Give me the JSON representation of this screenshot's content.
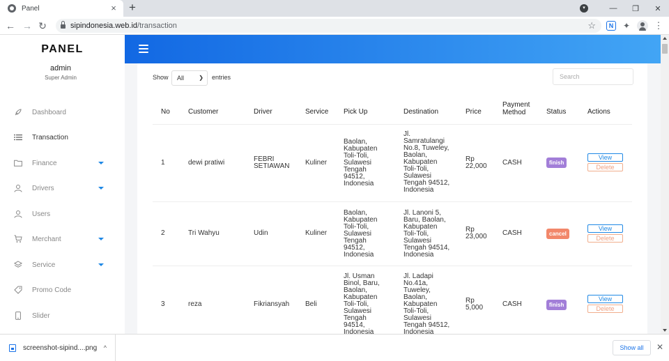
{
  "browser": {
    "tab_title": "Panel",
    "tab_close": "×",
    "new_tab": "+",
    "url_host": "sipindonesia.web.id",
    "url_path": "/transaction",
    "minimize": "—",
    "restore": "❐",
    "close": "✕",
    "ext_n": "N",
    "back": "←",
    "forward": "→",
    "reload": "↻",
    "star": "☆",
    "puzzle": "✦",
    "more": "⋮"
  },
  "sidebar": {
    "brand": "PANEL",
    "user_name": "admin",
    "user_role": "Super Admin",
    "items": [
      {
        "label": "Dashboard",
        "icon": "rocket-icon"
      },
      {
        "label": "Transaction",
        "icon": "list-icon"
      },
      {
        "label": "Finance",
        "icon": "folder-icon"
      },
      {
        "label": "Drivers",
        "icon": "drivers-icon"
      },
      {
        "label": "Users",
        "icon": "users-icon"
      },
      {
        "label": "Merchant",
        "icon": "cart-icon"
      },
      {
        "label": "Service",
        "icon": "layers-icon"
      },
      {
        "label": "Promo Code",
        "icon": "tag-icon"
      },
      {
        "label": "Slider",
        "icon": "phone-icon"
      }
    ]
  },
  "table_controls": {
    "show_label": "Show",
    "entries_value": "All",
    "entries_label": "entries",
    "search_placeholder": "Search"
  },
  "table": {
    "headers": {
      "no": "No",
      "customer": "Customer",
      "driver": "Driver",
      "service": "Service",
      "pickup": "Pick Up",
      "destination": "Destination",
      "price": "Price",
      "payment": "Payment\nMethod",
      "status": "Status",
      "actions": "Actions"
    },
    "rows": [
      {
        "no": "1",
        "customer": "dewi pratiwi",
        "driver": "FEBRI\nSETIAWAN",
        "service": "Kuliner",
        "pickup": "Baolan,\nKabupaten\nToli-Toli,\nSulawesi\nTengah\n94512,\nIndonesia",
        "destination": "Jl.\nSamratulangi\nNo.8, Tuweley,\nBaolan,\nKabupaten\nToli-Toli,\nSulawesi\nTengah 94512,\nIndonesia",
        "price": "Rp\n22,000",
        "payment": "CASH",
        "status": "finish",
        "view": "View",
        "delete": "Delete"
      },
      {
        "no": "2",
        "customer": "Tri Wahyu",
        "driver": "Udin",
        "service": "Kuliner",
        "pickup": "Baolan,\nKabupaten\nToli-Toli,\nSulawesi\nTengah\n94512,\nIndonesia",
        "destination": "Jl. Lanoni 5,\nBaru, Baolan,\nKabupaten\nToli-Toli,\nSulawesi\nTengah 94514,\nIndonesia",
        "price": "Rp\n23,000",
        "payment": "CASH",
        "status": "cancel",
        "view": "View",
        "delete": "Delete"
      },
      {
        "no": "3",
        "customer": "reza",
        "driver": "Fikriansyah",
        "service": "Beli",
        "pickup": "Jl. Usman\nBinol, Baru,\nBaolan,\nKabupaten\nToli-Toli,\nSulawesi\nTengah\n94514,\nIndonesia",
        "destination": "Jl. Ladapi\nNo.41a,\nTuweley,\nBaolan,\nKabupaten\nToli-Toli,\nSulawesi\nTengah 94512,\nIndonesia",
        "price": "Rp\n5,000",
        "payment": "CASH",
        "status": "finish",
        "view": "View",
        "delete": "Delete"
      }
    ]
  },
  "status_colors": {
    "finish": "#a27ed8",
    "cancel": "#f2876a"
  },
  "downloads": {
    "file_name": "screenshot-sipind....png",
    "chevron": "^",
    "show_all": "Show all",
    "close": "✕"
  }
}
